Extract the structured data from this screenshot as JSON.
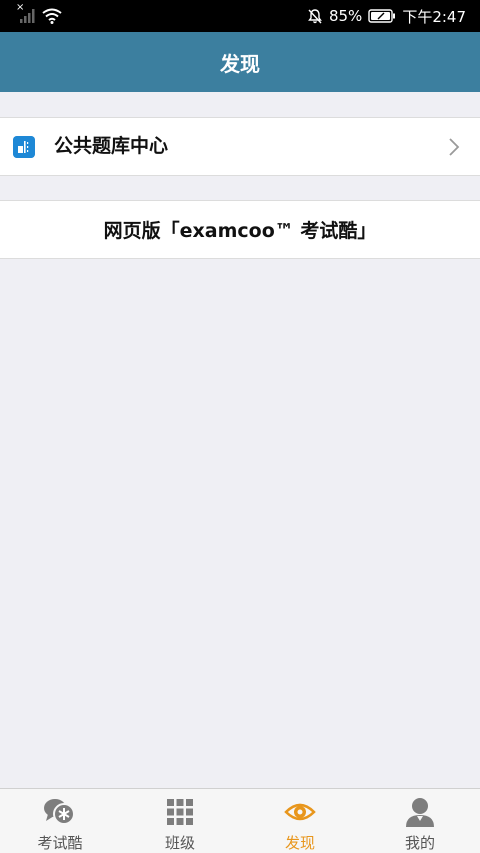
{
  "status_bar": {
    "battery": "85%",
    "time": "下午2:47"
  },
  "header": {
    "title": "发现"
  },
  "list": {
    "question_bank": "公共题库中心",
    "web_version": "网页版「examcoo™ 考试酷」"
  },
  "tab_bar": {
    "tabs": [
      {
        "label": "考试酷",
        "icon": "chat-star-icon"
      },
      {
        "label": "班级",
        "icon": "grid-icon"
      },
      {
        "label": "发现",
        "icon": "eye-icon"
      },
      {
        "label": "我的",
        "icon": "user-icon"
      }
    ],
    "active_index": 2,
    "active_color": "#e8961c",
    "inactive_color": "#7d7d7d"
  },
  "colors": {
    "header_bg": "#3c7f9f",
    "page_bg": "#efeff4",
    "icon_blue": "#1e88d6"
  }
}
